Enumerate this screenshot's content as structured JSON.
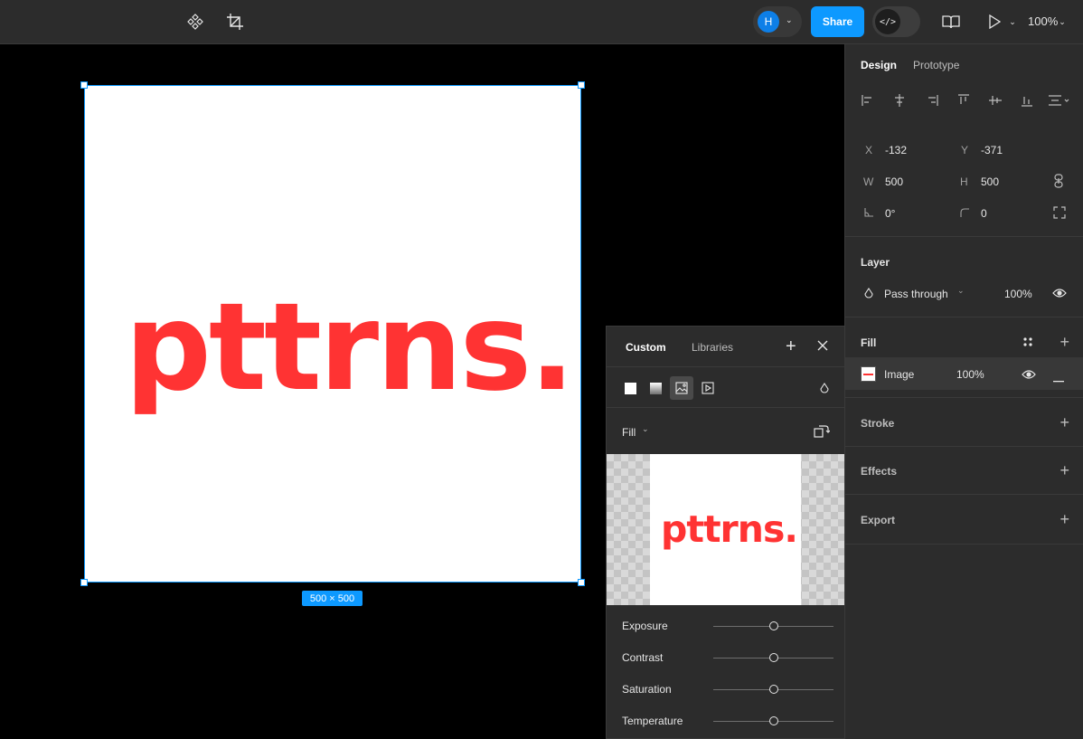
{
  "toolbar": {
    "avatar_initial": "H",
    "share_label": "Share",
    "devmode_icon": "</>",
    "zoom": "100%"
  },
  "canvas": {
    "frame_text": "pttrns.",
    "size_badge": "500 × 500",
    "accent_color": "#0d99ff",
    "logo_color": "#ff3333"
  },
  "fill_picker": {
    "tabs": [
      "Custom",
      "Libraries"
    ],
    "fill_mode": "Fill",
    "preview_text": "pttrns.",
    "adjustments": [
      {
        "label": "Exposure",
        "value": 0.5
      },
      {
        "label": "Contrast",
        "value": 0.5
      },
      {
        "label": "Saturation",
        "value": 0.5
      },
      {
        "label": "Temperature",
        "value": 0.5
      }
    ]
  },
  "panel": {
    "tabs": [
      "Design",
      "Prototype"
    ],
    "x_label": "X",
    "x_value": "-132",
    "y_label": "Y",
    "y_value": "-371",
    "w_label": "W",
    "w_value": "500",
    "h_label": "H",
    "h_value": "500",
    "rotation": "0°",
    "radius": "0",
    "layer_title": "Layer",
    "blend_mode": "Pass through",
    "layer_opacity": "100%",
    "fill_title": "Fill",
    "fill_type": "Image",
    "fill_opacity": "100%",
    "stroke_title": "Stroke",
    "effects_title": "Effects",
    "export_title": "Export"
  }
}
